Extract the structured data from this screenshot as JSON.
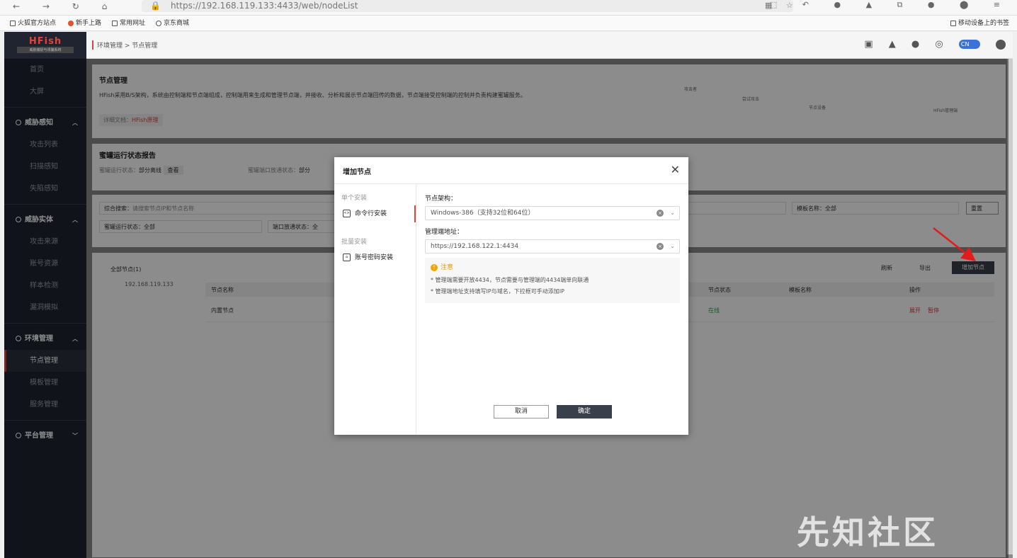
{
  "browser": {
    "url": "https://192.168.119.133:4433/web/nodeList",
    "bookmarks": [
      "火狐官方站点",
      "新手上路",
      "常用网址",
      "京东商城"
    ],
    "mobile_bookmarks": "移动设备上的书签"
  },
  "app": {
    "logo": "HFish",
    "logo_sub": "威胁捕捉与诱骗系统",
    "breadcrumb": "环境管理 > 节点管理",
    "lang": "CN",
    "sidebar": {
      "top_items": [
        "首页",
        "大屏"
      ],
      "groups": [
        {
          "label": "威胁感知",
          "items": [
            "攻击列表",
            "扫描感知",
            "失陷感知"
          ]
        },
        {
          "label": "威胁实体",
          "items": [
            "攻击来源",
            "账号资源",
            "样本检测",
            "漏洞模拟"
          ]
        },
        {
          "label": "环境管理",
          "items": [
            "节点管理",
            "模板管理",
            "服务管理"
          ]
        },
        {
          "label": "平台管理",
          "items": []
        }
      ]
    }
  },
  "page": {
    "title": "节点管理",
    "description": "HFish采用B/S架构，系统由控制端和节点端组成，控制端用来生成和管理节点端，并接收、分析和展示节点端回传的数据，节点端接受控制端的控制并负责构建蜜罐服务。",
    "doc_label": "详细文档：",
    "doc_link": "HFish原理",
    "diagram": {
      "attacker": "攻击者",
      "attack": "尝试攻击",
      "node": "节点设备",
      "manager": "HFish管理端"
    },
    "report_title": "蜜罐运行状态报告",
    "status_label": "蜜罐运行状态：",
    "status_value": "部分离线",
    "view": "查看",
    "port_label": "蜜罐端口放通状态：",
    "port_value": "部分",
    "search_label": "综合搜索：",
    "search_placeholder": "请搜索节点IP和节点名称",
    "template_filter": "模板名称：全部",
    "reset": "重置",
    "run_filter": "蜜罐运行状态：全部",
    "port_filter": "端口放通状态：全",
    "tree_root": "全部节点(1)",
    "tree_child": "192.168.119.133",
    "refresh": "刷新",
    "export": "导出",
    "add_node": "增加节点",
    "table_headers": [
      "节点名称",
      "节点状态",
      "模板名称",
      "操作"
    ],
    "row": {
      "name": "内置节点",
      "status": "在线",
      "action1": "展开",
      "action2": "暂停"
    }
  },
  "modal": {
    "title": "增加节点",
    "group1": "单个安装",
    "item1": "命令行安装",
    "group2": "批量安装",
    "item2": "账号密码安装",
    "arch_label": "节点架构：",
    "arch_value": "Windows-386（支持32位和64位）",
    "addr_label": "管理端地址：",
    "addr_value": "https://192.168.122.1:4434",
    "note_title": "注意",
    "note_lines": [
      "* 管理端需要开放4434，节点需要与管理端的4434端单向联通",
      "* 管理端地址支持填写IP与域名，下拉框可手动添加IP"
    ],
    "cancel": "取消",
    "ok": "确定"
  },
  "watermark": "先知社区",
  "colors": {
    "accent": "#e0433a",
    "sidebar": "#1f2430",
    "online": "#3aa33a",
    "warn": "#f0a500"
  }
}
